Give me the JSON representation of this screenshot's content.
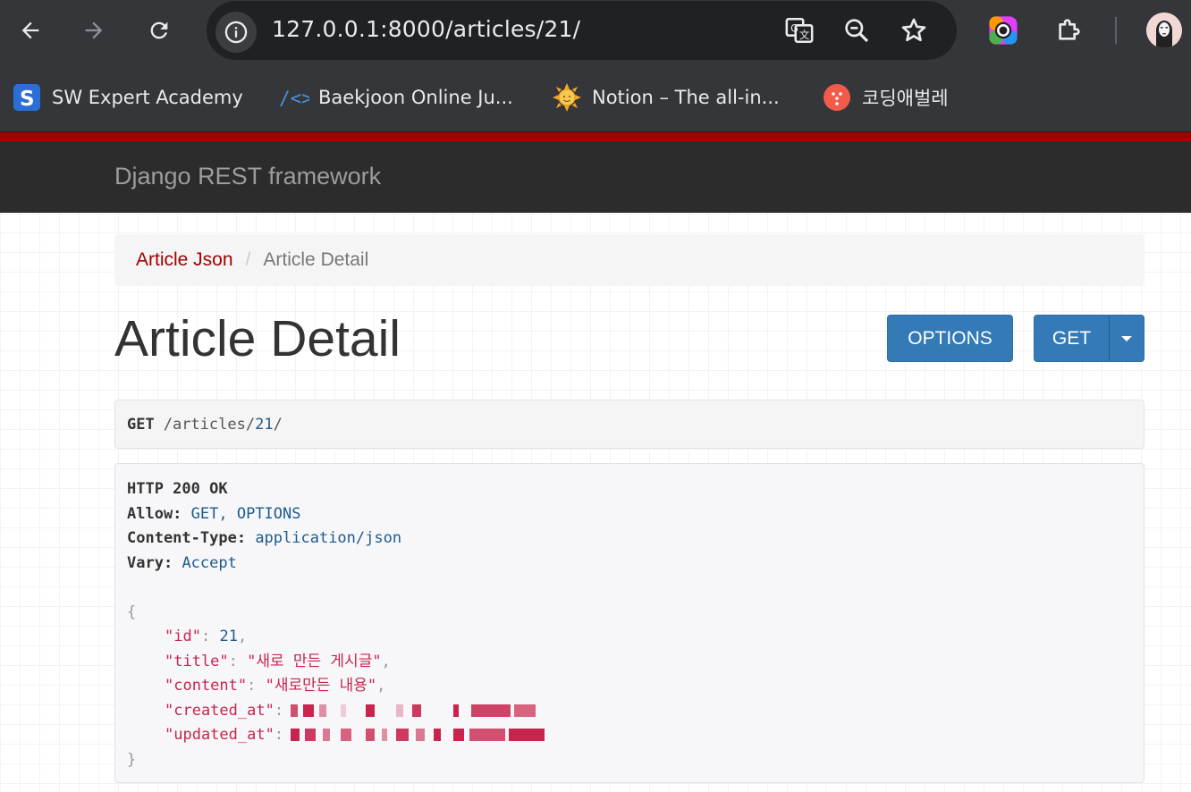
{
  "browser": {
    "url": "127.0.0.1:8000/articles/21/",
    "bookmarks": [
      {
        "label": "SW Expert Academy",
        "icon": "swea-icon"
      },
      {
        "label": "Baekjoon Online Ju...",
        "icon": "code-icon"
      },
      {
        "label": "Notion – The all-in...",
        "icon": "sun-icon"
      },
      {
        "label": "코딩애벌레",
        "icon": "bug-icon"
      }
    ]
  },
  "navbar": {
    "brand": "Django REST framework"
  },
  "breadcrumb": {
    "parent": "Article Json",
    "separator": "/",
    "current": "Article Detail"
  },
  "page": {
    "title": "Article Detail"
  },
  "buttons": {
    "options": "OPTIONS",
    "get": "GET"
  },
  "request": {
    "method": "GET",
    "path_prefix": "/articles/",
    "path_id": "21",
    "path_suffix": "/"
  },
  "response": {
    "status": "HTTP 200 OK",
    "headers": [
      {
        "key": "Allow:",
        "value": "GET, OPTIONS"
      },
      {
        "key": "Content-Type:",
        "value": "application/json"
      },
      {
        "key": "Vary:",
        "value": "Accept"
      }
    ],
    "open_brace": "{",
    "close_brace": "}",
    "fields": {
      "id_key": "\"id\"",
      "id_value": "21",
      "title_key": "\"title\"",
      "title_value": "\"새로 만든 게시글\"",
      "content_key": "\"content\"",
      "content_value": "\"새로만든 내용\"",
      "created_key": "\"created_at\"",
      "updated_key": "\"updated_at\""
    },
    "colon": ":",
    "comma": ","
  },
  "colors": {
    "accent": "#a30000",
    "primary": "#337ab7",
    "navbar": "#2c2c2c"
  }
}
